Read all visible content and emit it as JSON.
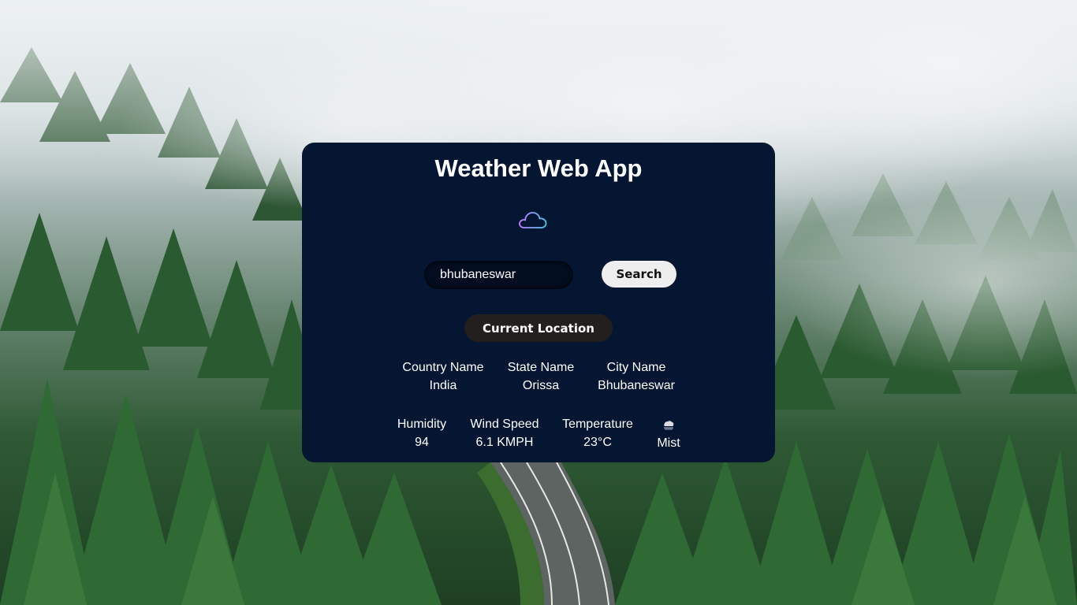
{
  "app": {
    "title": "Weather Web App"
  },
  "search": {
    "value": "bhubaneswar",
    "placeholder": "",
    "button_label": "Search"
  },
  "location_button_label": "Current Location",
  "location": {
    "country": {
      "label": "Country Name",
      "value": "India"
    },
    "state": {
      "label": "State Name",
      "value": "Orissa"
    },
    "city": {
      "label": "City Name",
      "value": "Bhubaneswar"
    }
  },
  "weather": {
    "humidity": {
      "label": "Humidity",
      "value": "94"
    },
    "wind": {
      "label": "Wind Speed",
      "value": "6.1 KMPH"
    },
    "temperature": {
      "label": "Temperature",
      "value": "23°C"
    },
    "condition": {
      "icon": "mist-cloud-icon",
      "value": "Mist"
    }
  },
  "icons": {
    "header": "cloud-outline-icon"
  },
  "colors": {
    "card_bg": "#051633",
    "search_button_bg": "#eeeeee",
    "location_button_bg": "#231f1e",
    "cloud_gradient_start": "#c77dff",
    "cloud_gradient_end": "#4cc9f0"
  }
}
